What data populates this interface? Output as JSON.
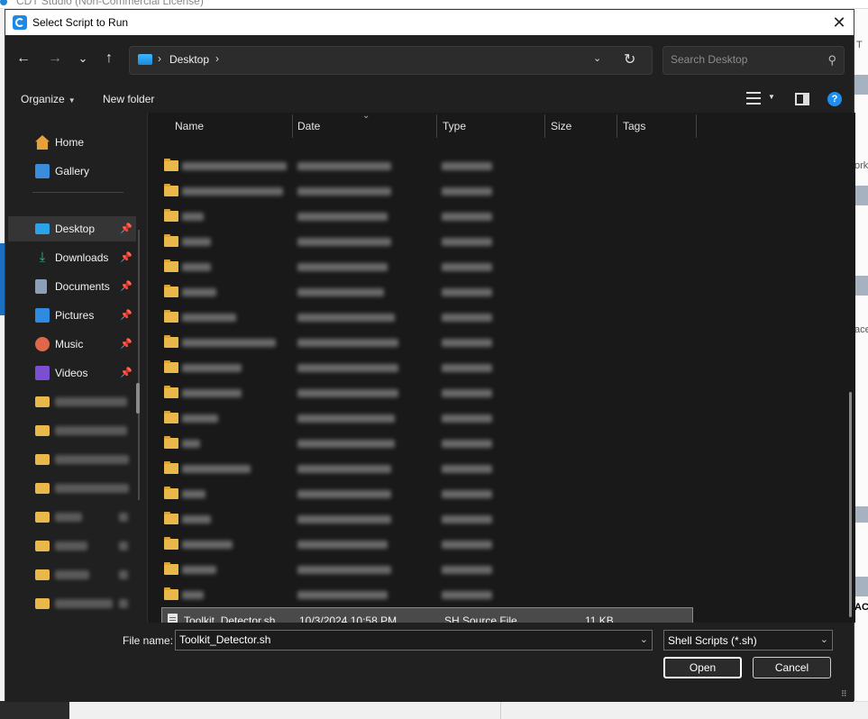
{
  "background": {
    "window_title": "CDT Studio (Non-Commercial License)",
    "right_fragments": [
      "T",
      "ork",
      "ace",
      "AC"
    ]
  },
  "dialog": {
    "title": "Select Script to Run",
    "close_label": "✕"
  },
  "nav": {
    "back": "←",
    "forward": "→",
    "recent": "⌄",
    "up": "↑",
    "address_crumb": "Desktop",
    "refresh": "↻",
    "search_placeholder": "Search Desktop",
    "search_value": ""
  },
  "toolbar": {
    "organize": "Organize",
    "new_folder": "New folder",
    "help": "?"
  },
  "sidebar": {
    "items": [
      {
        "label": "Home",
        "icon": "home-icon",
        "color": "#e8a03c",
        "pinned": false
      },
      {
        "label": "Gallery",
        "icon": "gallery-icon",
        "color": "#3b8ddb",
        "pinned": false
      },
      {
        "label": "Desktop",
        "icon": "desktop-icon",
        "color": "#2aa3e8",
        "pinned": true,
        "selected": true
      },
      {
        "label": "Downloads",
        "icon": "downloads-icon",
        "color": "#3fb39a",
        "pinned": true
      },
      {
        "label": "Documents",
        "icon": "documents-icon",
        "color": "#8aa0b8",
        "pinned": true
      },
      {
        "label": "Pictures",
        "icon": "pictures-icon",
        "color": "#2f8be0",
        "pinned": true
      },
      {
        "label": "Music",
        "icon": "music-icon",
        "color": "#e0674a",
        "pinned": true
      },
      {
        "label": "Videos",
        "icon": "videos-icon",
        "color": "#7a4fd0",
        "pinned": true
      }
    ],
    "pin_glyph": "📌"
  },
  "filelist": {
    "columns": [
      "Name",
      "Date",
      "Type",
      "Size",
      "Tags"
    ],
    "selected_file": {
      "name": "Toolkit_Detector.sh",
      "date": "10/3/2024 10:58 PM",
      "type": "SH Source File",
      "size": "11 KB"
    }
  },
  "bottom": {
    "file_name_label": "File name:",
    "file_name_value": "Toolkit_Detector.sh",
    "file_type": "Shell Scripts (*.sh)",
    "open_label": "Open",
    "cancel_label": "Cancel"
  },
  "colors": {
    "dialog_bg": "#202020",
    "list_bg": "#191919",
    "accent": "#1e8ef0",
    "folder": "#e8b84a"
  }
}
